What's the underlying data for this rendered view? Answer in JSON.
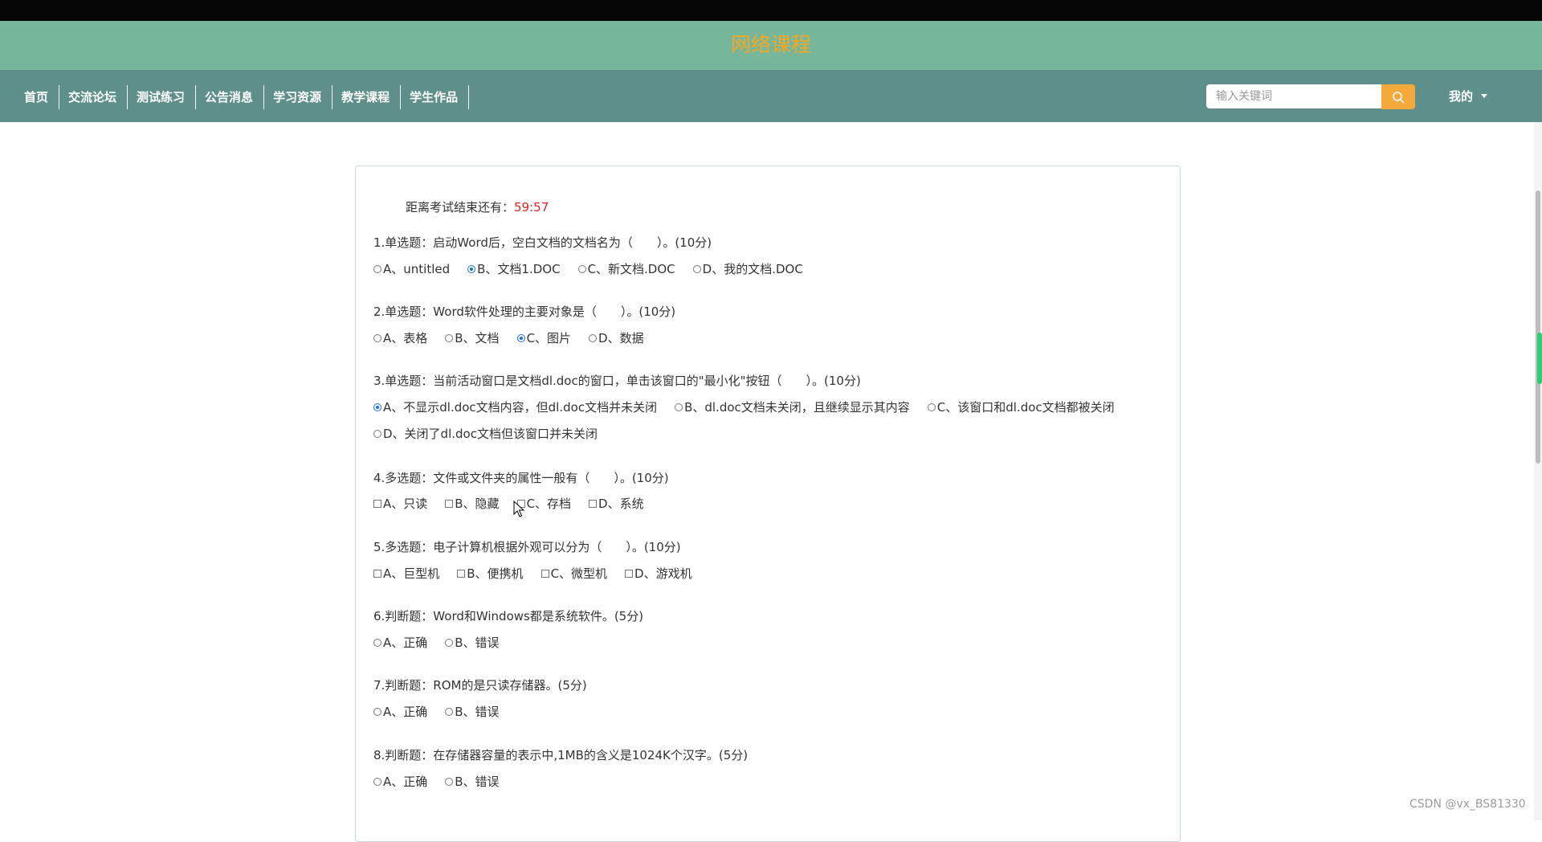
{
  "site": {
    "title": "网络课程"
  },
  "nav": {
    "items": [
      "首页",
      "交流论坛",
      "测试练习",
      "公告消息",
      "学习资源",
      "教学课程",
      "学生作品"
    ]
  },
  "search": {
    "placeholder": "输入关键词",
    "icon": "search-icon"
  },
  "user_menu": {
    "label": "我的"
  },
  "exam": {
    "timer_label": "距离考试结束还有：",
    "timer_value": "59:57",
    "questions": [
      {
        "text": "1.单选题：启动Word后，空白文档的文档名为（　　）。(10分)",
        "options": [
          "A、untitled",
          "B、文档1.DOC",
          "C、新文档.DOC",
          "D、我的文档.DOC"
        ],
        "selected": "B"
      },
      {
        "text": "2.单选题：Word软件处理的主要对象是（　　）。(10分)",
        "options": [
          "A、表格",
          "B、文档",
          "C、图片",
          "D、数据"
        ],
        "selected": "C"
      },
      {
        "text": "3.单选题：当前活动窗口是文档dl.doc的窗口，单击该窗口的\"最小化\"按钮（　　）。(10分)",
        "options": [
          "A、不显示dl.doc文档内容，但dl.doc文档并未关闭",
          "B、dl.doc文档未关闭，且继续显示其内容",
          "C、该窗口和dl.doc文档都被关闭",
          "D、关闭了dl.doc文档但该窗口并未关闭"
        ],
        "selected": "A"
      },
      {
        "text": "4.多选题：文件或文件夹的属性一般有（　　）。(10分)",
        "options": [
          "A、只读",
          "B、隐藏",
          "C、存档",
          "D、系统"
        ],
        "selected": ""
      },
      {
        "text": "5.多选题：电子计算机根据外观可以分为（　　）。(10分)",
        "options": [
          "A、巨型机",
          "B、便携机",
          "C、微型机",
          "D、游戏机"
        ],
        "selected": ""
      },
      {
        "text": "6.判断题：Word和Windows都是系统软件。(5分)",
        "options": [
          "A、正确",
          "B、错误"
        ],
        "selected": ""
      },
      {
        "text": "7.判断题：ROM的是只读存储器。(5分)",
        "options": [
          "A、正确",
          "B、错误"
        ],
        "selected": ""
      },
      {
        "text": "8.判断题：在存储器容量的表示中,1MB的含义是1024K个汉字。(5分)",
        "options": [
          "A、正确",
          "B、错误"
        ],
        "selected": ""
      }
    ]
  },
  "watermark": "CSDN @vx_BS81330",
  "colors": {
    "banner": "#76b79b",
    "navbar": "#5e8f8a",
    "title": "#f5a623",
    "search_button": "#f6a93b",
    "timer": "#e02424"
  }
}
